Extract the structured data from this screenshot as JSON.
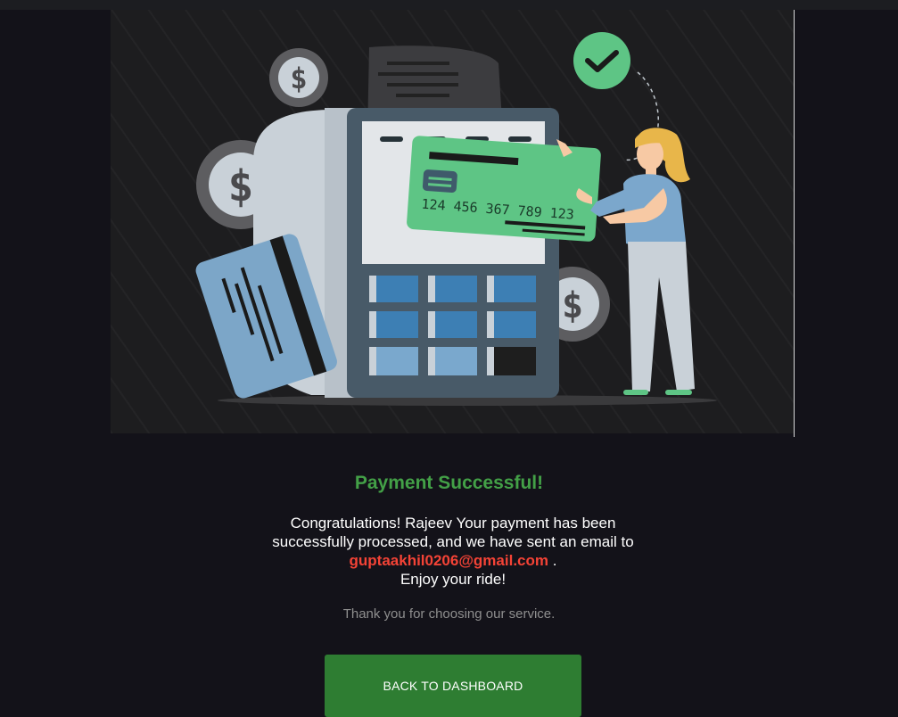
{
  "hero": {
    "card_number": "124 456 367 789 123"
  },
  "payment": {
    "title": "Payment Successful!",
    "message_prefix": "Congratulations! Rajeev Your payment has been successfully processed, and we have sent an email to",
    "email": "guptaakhil0206@gmail.com",
    "message_suffix": ".",
    "message_end": "Enjoy your ride!",
    "thanks": "Thank you for choosing our service."
  },
  "actions": {
    "back_label": "BACK TO DASHBOARD"
  },
  "colors": {
    "background": "#131219",
    "success_green": "#43a047",
    "button_green": "#2e7d32",
    "email_red": "#f44336"
  },
  "icons": [
    "dollar-coin-icon",
    "check-circle-icon"
  ]
}
